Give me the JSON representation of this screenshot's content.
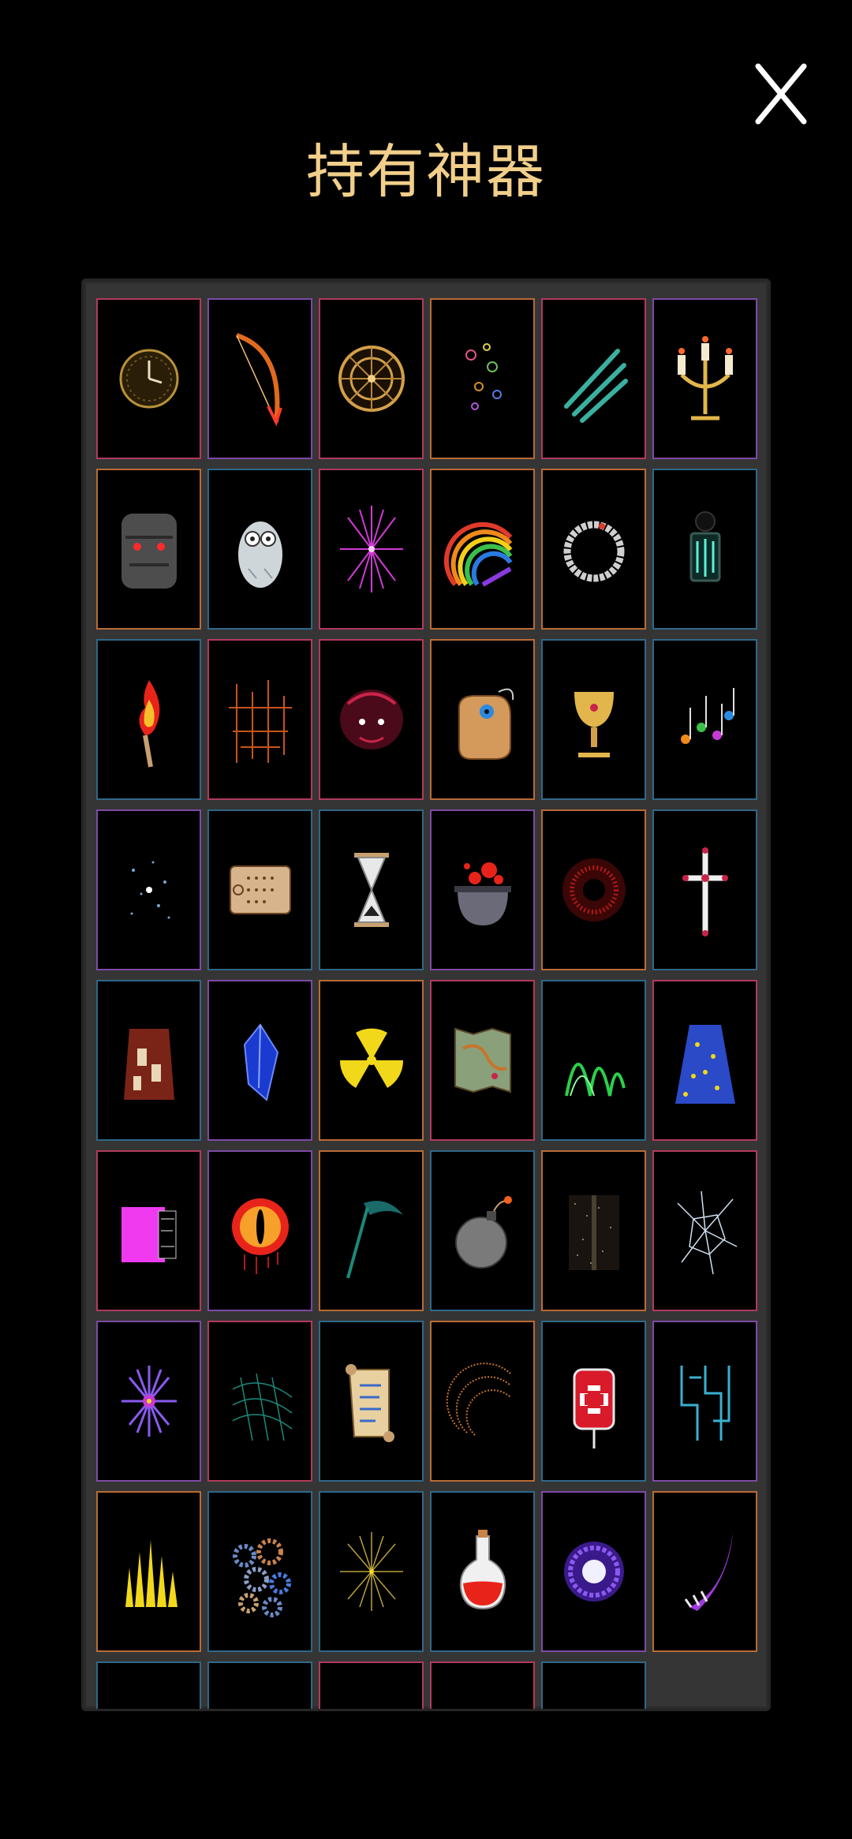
{
  "header": {
    "title": "持有神器",
    "close_icon": "close-icon"
  },
  "colors": {
    "title": "#f1cf8a",
    "background": "#000000",
    "panel": "#353535",
    "border_red": "#b13a5e",
    "border_purple": "#7e4aa5",
    "border_blue": "#2f6888",
    "border_orange": "#b86b35"
  },
  "artifacts": [
    {
      "icon": "clock-face-icon",
      "border": "#b13a5e"
    },
    {
      "icon": "flaming-bow-icon",
      "border": "#7e4aa5"
    },
    {
      "icon": "golden-compass-wheel-icon",
      "border": "#b13a5e"
    },
    {
      "icon": "colorful-glyphs-icon",
      "border": "#b86b35"
    },
    {
      "icon": "cyan-claw-marks-icon",
      "border": "#b13a5e"
    },
    {
      "icon": "candelabra-icon",
      "border": "#7e4aa5"
    },
    {
      "icon": "stone-golem-face-icon",
      "border": "#b86b35"
    },
    {
      "icon": "white-owl-icon",
      "border": "#2f6888"
    },
    {
      "icon": "pink-spark-burst-icon",
      "border": "#b13a5e"
    },
    {
      "icon": "rainbow-icon",
      "border": "#b86b35"
    },
    {
      "icon": "ouroboros-ring-icon",
      "border": "#b86b35"
    },
    {
      "icon": "lantern-icon",
      "border": "#2f6888"
    },
    {
      "icon": "flaming-torch-icon",
      "border": "#2f6888"
    },
    {
      "icon": "orange-lines-icon",
      "border": "#b13a5e"
    },
    {
      "icon": "crimson-beast-icon",
      "border": "#b13a5e"
    },
    {
      "icon": "eye-pouch-icon",
      "border": "#b86b35"
    },
    {
      "icon": "golden-chalice-icon",
      "border": "#2f6888"
    },
    {
      "icon": "music-notes-icon",
      "border": "#2f6888"
    },
    {
      "icon": "blue-stardust-icon",
      "border": "#7e4aa5"
    },
    {
      "icon": "calendar-scroll-icon",
      "border": "#2f6888"
    },
    {
      "icon": "hourglass-icon",
      "border": "#2f6888"
    },
    {
      "icon": "bubbling-cauldron-icon",
      "border": "#7e4aa5"
    },
    {
      "icon": "red-vortex-icon",
      "border": "#b86b35"
    },
    {
      "icon": "ornate-cross-icon",
      "border": "#2f6888"
    },
    {
      "icon": "tattered-robe-icon",
      "border": "#2f6888"
    },
    {
      "icon": "blue-crystal-icon",
      "border": "#7e4aa5"
    },
    {
      "icon": "radiation-symbol-icon",
      "border": "#b86b35"
    },
    {
      "icon": "treasure-map-icon",
      "border": "#b13a5e"
    },
    {
      "icon": "aurora-icon",
      "border": "#2f6888"
    },
    {
      "icon": "starry-cloak-icon",
      "border": "#b13a5e"
    },
    {
      "icon": "glitch-block-icon",
      "border": "#b13a5e"
    },
    {
      "icon": "burning-eye-icon",
      "border": "#7e4aa5"
    },
    {
      "icon": "scythe-icon",
      "border": "#b86b35"
    },
    {
      "icon": "lit-bomb-icon",
      "border": "#2f6888"
    },
    {
      "icon": "static-noise-icon",
      "border": "#b86b35"
    },
    {
      "icon": "shattered-glass-icon",
      "border": "#b13a5e"
    },
    {
      "icon": "purple-star-burst-icon",
      "border": "#7e4aa5"
    },
    {
      "icon": "teal-net-icon",
      "border": "#b13a5e"
    },
    {
      "icon": "ancient-scroll-icon",
      "border": "#2f6888"
    },
    {
      "icon": "spiral-text-icon",
      "border": "#b86b35"
    },
    {
      "icon": "blood-bag-icon",
      "border": "#2f6888"
    },
    {
      "icon": "circuit-lines-icon",
      "border": "#7e4aa5"
    },
    {
      "icon": "golden-spikes-icon",
      "border": "#b86b35"
    },
    {
      "icon": "gears-icon",
      "border": "#2f6888"
    },
    {
      "icon": "golden-sparkle-icon",
      "border": "#2f6888"
    },
    {
      "icon": "red-potion-icon",
      "border": "#2f6888"
    },
    {
      "icon": "purple-portal-icon",
      "border": "#7e4aa5"
    },
    {
      "icon": "purple-claw-icon",
      "border": "#b86b35"
    },
    {
      "icon": "blue-swirl-icon",
      "border": "#2f6888"
    },
    {
      "icon": "dark-shape-icon",
      "border": "#2f6888"
    },
    {
      "icon": "purple-grass-icon",
      "border": "#b13a5e"
    },
    {
      "icon": "red-blade-icon",
      "border": "#b13a5e"
    },
    {
      "icon": "cyan-orb-icon",
      "border": "#2f6888"
    }
  ]
}
